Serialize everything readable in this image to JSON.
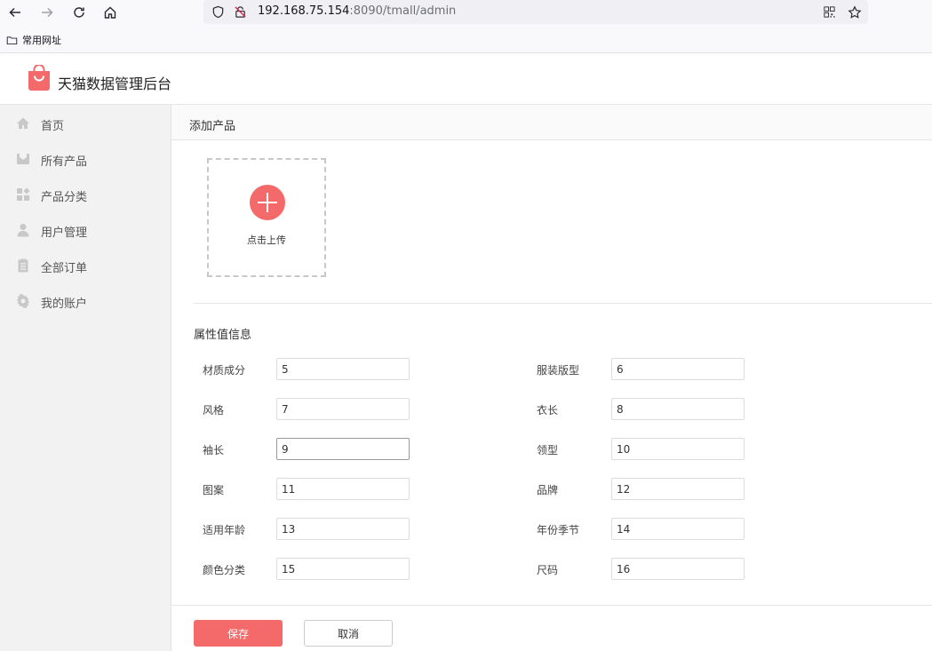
{
  "browser": {
    "url_host": "192.168.75.154",
    "url_rest": ":8090/tmall/admin",
    "bookmark_folder": "常用网址"
  },
  "app": {
    "title": "天猫数据管理后台",
    "accent_color": "#f46a6a"
  },
  "sidebar": {
    "items": [
      {
        "label": "首页",
        "icon": "home-icon"
      },
      {
        "label": "所有产品",
        "icon": "products-icon"
      },
      {
        "label": "产品分类",
        "icon": "category-icon"
      },
      {
        "label": "用户管理",
        "icon": "user-icon"
      },
      {
        "label": "全部订单",
        "icon": "orders-icon"
      },
      {
        "label": "我的账户",
        "icon": "gear-icon"
      }
    ]
  },
  "main": {
    "page_title": "添加产品",
    "upload_label": "点击上传",
    "section_title": "属性值信息",
    "fields": [
      {
        "label": "材质成分",
        "value": "5"
      },
      {
        "label": "服装版型",
        "value": "6"
      },
      {
        "label": "风格",
        "value": "7"
      },
      {
        "label": "衣长",
        "value": "8"
      },
      {
        "label": "袖长",
        "value": "9"
      },
      {
        "label": "领型",
        "value": "10"
      },
      {
        "label": "图案",
        "value": "11"
      },
      {
        "label": "品牌",
        "value": "12"
      },
      {
        "label": "适用年龄",
        "value": "13"
      },
      {
        "label": "年份季节",
        "value": "14"
      },
      {
        "label": "颜色分类",
        "value": "15"
      },
      {
        "label": "尺码",
        "value": "16"
      }
    ],
    "save_label": "保存",
    "cancel_label": "取消"
  }
}
